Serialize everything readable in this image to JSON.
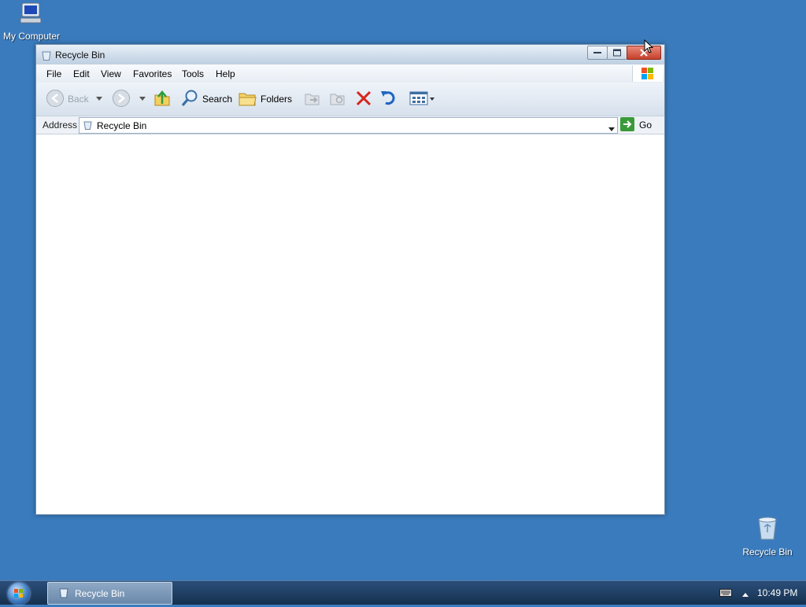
{
  "desktop": {
    "icons": [
      {
        "label": "My Computer",
        "icon": "computer-icon"
      },
      {
        "label": "Recycle Bin",
        "icon": "recycle-bin-icon"
      }
    ]
  },
  "window": {
    "title": "Recycle Bin",
    "menu": [
      "File",
      "Edit",
      "View",
      "Favorites",
      "Tools",
      "Help"
    ],
    "toolbar": {
      "back_label": "Back",
      "search_label": "Search",
      "folders_label": "Folders"
    },
    "address": {
      "label": "Address",
      "value": "Recycle Bin",
      "go_label": "Go"
    }
  },
  "taskbar": {
    "active_task": "Recycle Bin",
    "clock": "10:49 PM"
  },
  "colors": {
    "desktop": "#3a7bbd",
    "close_button": "#c6402b"
  }
}
